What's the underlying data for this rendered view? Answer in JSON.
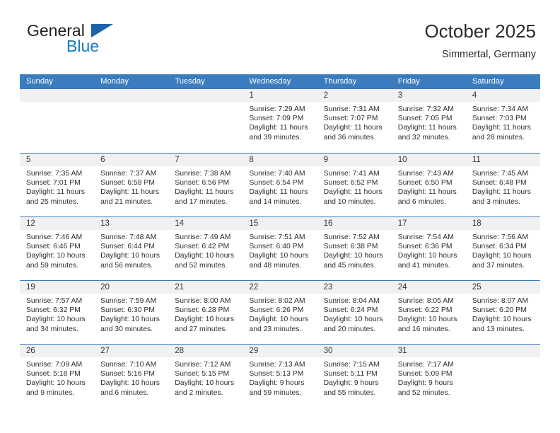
{
  "brand": {
    "name_top": "General",
    "name_bottom": "Blue",
    "triangle_color": "#1e63a8",
    "blue_color": "#1479c4"
  },
  "header": {
    "title": "October 2025",
    "subtitle": "Simmertal, Germany"
  },
  "theme": {
    "header_row_bg": "#3a7cbe",
    "header_row_text": "#ffffff",
    "daynum_band_bg": "#f1f1f1",
    "week_separator": "#3a7cbe",
    "body_text": "#2e2e2e"
  },
  "weekdays": [
    "Sunday",
    "Monday",
    "Tuesday",
    "Wednesday",
    "Thursday",
    "Friday",
    "Saturday"
  ],
  "labels": {
    "sunrise": "Sunrise:",
    "sunset": "Sunset:",
    "daylight": "Daylight:"
  },
  "weeks": [
    [
      {
        "day": "",
        "empty": true
      },
      {
        "day": "",
        "empty": true
      },
      {
        "day": "",
        "empty": true
      },
      {
        "day": "1",
        "sunrise": "Sunrise: 7:29 AM",
        "sunset": "Sunset: 7:09 PM",
        "daylight1": "Daylight: 11 hours",
        "daylight2": "and 39 minutes."
      },
      {
        "day": "2",
        "sunrise": "Sunrise: 7:31 AM",
        "sunset": "Sunset: 7:07 PM",
        "daylight1": "Daylight: 11 hours",
        "daylight2": "and 36 minutes."
      },
      {
        "day": "3",
        "sunrise": "Sunrise: 7:32 AM",
        "sunset": "Sunset: 7:05 PM",
        "daylight1": "Daylight: 11 hours",
        "daylight2": "and 32 minutes."
      },
      {
        "day": "4",
        "sunrise": "Sunrise: 7:34 AM",
        "sunset": "Sunset: 7:03 PM",
        "daylight1": "Daylight: 11 hours",
        "daylight2": "and 28 minutes."
      }
    ],
    [
      {
        "day": "5",
        "sunrise": "Sunrise: 7:35 AM",
        "sunset": "Sunset: 7:01 PM",
        "daylight1": "Daylight: 11 hours",
        "daylight2": "and 25 minutes."
      },
      {
        "day": "6",
        "sunrise": "Sunrise: 7:37 AM",
        "sunset": "Sunset: 6:58 PM",
        "daylight1": "Daylight: 11 hours",
        "daylight2": "and 21 minutes."
      },
      {
        "day": "7",
        "sunrise": "Sunrise: 7:38 AM",
        "sunset": "Sunset: 6:56 PM",
        "daylight1": "Daylight: 11 hours",
        "daylight2": "and 17 minutes."
      },
      {
        "day": "8",
        "sunrise": "Sunrise: 7:40 AM",
        "sunset": "Sunset: 6:54 PM",
        "daylight1": "Daylight: 11 hours",
        "daylight2": "and 14 minutes."
      },
      {
        "day": "9",
        "sunrise": "Sunrise: 7:41 AM",
        "sunset": "Sunset: 6:52 PM",
        "daylight1": "Daylight: 11 hours",
        "daylight2": "and 10 minutes."
      },
      {
        "day": "10",
        "sunrise": "Sunrise: 7:43 AM",
        "sunset": "Sunset: 6:50 PM",
        "daylight1": "Daylight: 11 hours",
        "daylight2": "and 6 minutes."
      },
      {
        "day": "11",
        "sunrise": "Sunrise: 7:45 AM",
        "sunset": "Sunset: 6:48 PM",
        "daylight1": "Daylight: 11 hours",
        "daylight2": "and 3 minutes."
      }
    ],
    [
      {
        "day": "12",
        "sunrise": "Sunrise: 7:46 AM",
        "sunset": "Sunset: 6:46 PM",
        "daylight1": "Daylight: 10 hours",
        "daylight2": "and 59 minutes."
      },
      {
        "day": "13",
        "sunrise": "Sunrise: 7:48 AM",
        "sunset": "Sunset: 6:44 PM",
        "daylight1": "Daylight: 10 hours",
        "daylight2": "and 56 minutes."
      },
      {
        "day": "14",
        "sunrise": "Sunrise: 7:49 AM",
        "sunset": "Sunset: 6:42 PM",
        "daylight1": "Daylight: 10 hours",
        "daylight2": "and 52 minutes."
      },
      {
        "day": "15",
        "sunrise": "Sunrise: 7:51 AM",
        "sunset": "Sunset: 6:40 PM",
        "daylight1": "Daylight: 10 hours",
        "daylight2": "and 48 minutes."
      },
      {
        "day": "16",
        "sunrise": "Sunrise: 7:52 AM",
        "sunset": "Sunset: 6:38 PM",
        "daylight1": "Daylight: 10 hours",
        "daylight2": "and 45 minutes."
      },
      {
        "day": "17",
        "sunrise": "Sunrise: 7:54 AM",
        "sunset": "Sunset: 6:36 PM",
        "daylight1": "Daylight: 10 hours",
        "daylight2": "and 41 minutes."
      },
      {
        "day": "18",
        "sunrise": "Sunrise: 7:56 AM",
        "sunset": "Sunset: 6:34 PM",
        "daylight1": "Daylight: 10 hours",
        "daylight2": "and 37 minutes."
      }
    ],
    [
      {
        "day": "19",
        "sunrise": "Sunrise: 7:57 AM",
        "sunset": "Sunset: 6:32 PM",
        "daylight1": "Daylight: 10 hours",
        "daylight2": "and 34 minutes."
      },
      {
        "day": "20",
        "sunrise": "Sunrise: 7:59 AM",
        "sunset": "Sunset: 6:30 PM",
        "daylight1": "Daylight: 10 hours",
        "daylight2": "and 30 minutes."
      },
      {
        "day": "21",
        "sunrise": "Sunrise: 8:00 AM",
        "sunset": "Sunset: 6:28 PM",
        "daylight1": "Daylight: 10 hours",
        "daylight2": "and 27 minutes."
      },
      {
        "day": "22",
        "sunrise": "Sunrise: 8:02 AM",
        "sunset": "Sunset: 6:26 PM",
        "daylight1": "Daylight: 10 hours",
        "daylight2": "and 23 minutes."
      },
      {
        "day": "23",
        "sunrise": "Sunrise: 8:04 AM",
        "sunset": "Sunset: 6:24 PM",
        "daylight1": "Daylight: 10 hours",
        "daylight2": "and 20 minutes."
      },
      {
        "day": "24",
        "sunrise": "Sunrise: 8:05 AM",
        "sunset": "Sunset: 6:22 PM",
        "daylight1": "Daylight: 10 hours",
        "daylight2": "and 16 minutes."
      },
      {
        "day": "25",
        "sunrise": "Sunrise: 8:07 AM",
        "sunset": "Sunset: 6:20 PM",
        "daylight1": "Daylight: 10 hours",
        "daylight2": "and 13 minutes."
      }
    ],
    [
      {
        "day": "26",
        "sunrise": "Sunrise: 7:09 AM",
        "sunset": "Sunset: 5:18 PM",
        "daylight1": "Daylight: 10 hours",
        "daylight2": "and 9 minutes."
      },
      {
        "day": "27",
        "sunrise": "Sunrise: 7:10 AM",
        "sunset": "Sunset: 5:16 PM",
        "daylight1": "Daylight: 10 hours",
        "daylight2": "and 6 minutes."
      },
      {
        "day": "28",
        "sunrise": "Sunrise: 7:12 AM",
        "sunset": "Sunset: 5:15 PM",
        "daylight1": "Daylight: 10 hours",
        "daylight2": "and 2 minutes."
      },
      {
        "day": "29",
        "sunrise": "Sunrise: 7:13 AM",
        "sunset": "Sunset: 5:13 PM",
        "daylight1": "Daylight: 9 hours",
        "daylight2": "and 59 minutes."
      },
      {
        "day": "30",
        "sunrise": "Sunrise: 7:15 AM",
        "sunset": "Sunset: 5:11 PM",
        "daylight1": "Daylight: 9 hours",
        "daylight2": "and 55 minutes."
      },
      {
        "day": "31",
        "sunrise": "Sunrise: 7:17 AM",
        "sunset": "Sunset: 5:09 PM",
        "daylight1": "Daylight: 9 hours",
        "daylight2": "and 52 minutes."
      },
      {
        "day": "",
        "empty": true
      }
    ]
  ]
}
